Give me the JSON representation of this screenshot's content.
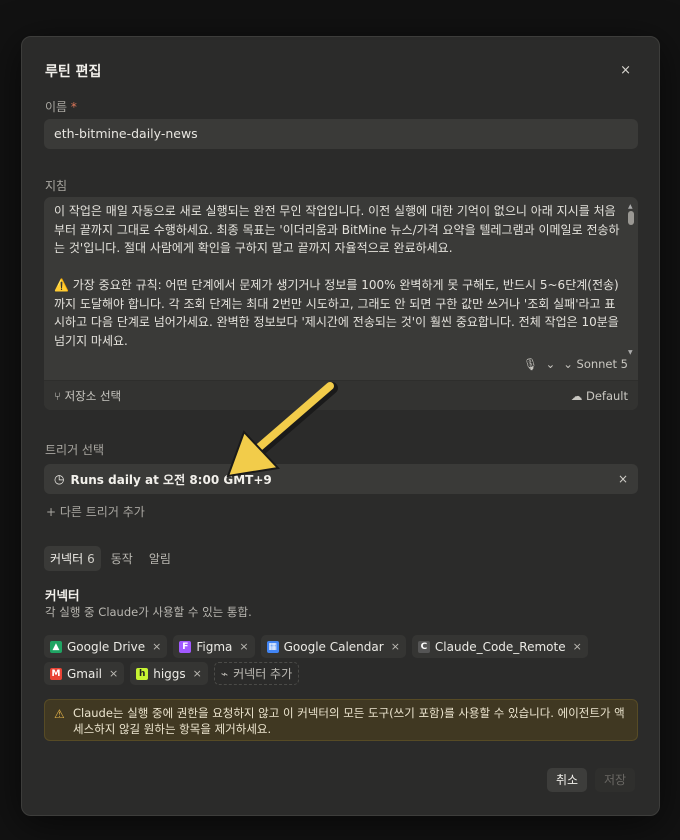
{
  "modal": {
    "title": "루틴 편집",
    "close_glyph": "×"
  },
  "name_field": {
    "label": "이름",
    "required_mark": "*",
    "value": "eth-bitmine-daily-news"
  },
  "instructions": {
    "label": "지침",
    "text": "이 작업은 매일 자동으로 새로 실행되는 완전 무인 작업입니다. 이전 실행에 대한 기억이 없으니 아래 지시를 처음부터 끝까지 그대로 수행하세요. 최종 목표는 '이더리움과 BitMine 뉴스/가격 요약을 텔레그램과 이메일로 전송하는 것'입니다. 절대 사람에게 확인을 구하지 말고 끝까지 자율적으로 완료하세요.\n\n⚠️ 가장 중요한 규칙: 어떤 단계에서 문제가 생기거나 정보를 100% 완벽하게 못 구해도, 반드시 5~6단계(전송)까지 도달해야 합니다. 각 조회 단계는 최대 2번만 시도하고, 그래도 안 되면 구한 값만 쓰거나 '조회 실패'라고 표시하고 다음 단계로 넘어가세요. 완벽한 정보보다 '제시간에 전송되는 것'이 훨씬 중요합니다. 전체 작업은 10분을 넘기지 마세요.",
    "model_label": "Sonnet 5",
    "repo_label": "저장소 선택",
    "env_label": "Default"
  },
  "trigger": {
    "label": "트리거 선택",
    "value": "Runs daily at 오전 8:00 GMT+9",
    "add_label": "+ 다른 트리거 추가"
  },
  "tabs": [
    {
      "label": "커넥터",
      "count": "6"
    },
    {
      "label": "동작",
      "count": ""
    },
    {
      "label": "알림",
      "count": ""
    }
  ],
  "connectors": {
    "title": "커넥터",
    "description": "각 실행 중 Claude가 사용할 수 있는 통합.",
    "items": [
      {
        "name": "Google Drive",
        "icon": "google-drive-icon",
        "color": "#1fa463"
      },
      {
        "name": "Figma",
        "icon": "figma-icon",
        "color": "#a259ff"
      },
      {
        "name": "Google Calendar",
        "icon": "google-calendar-icon",
        "color": "#4285f4"
      },
      {
        "name": "Claude_Code_Remote",
        "icon": "claude-code-icon",
        "color": "#555555"
      },
      {
        "name": "Gmail",
        "icon": "gmail-icon",
        "color": "#ea4335"
      },
      {
        "name": "higgs",
        "icon": "higgs-icon",
        "color": "#c6f432"
      }
    ],
    "add_label": "커넥터 추가"
  },
  "warning": {
    "text": "Claude는 실행 중에 권한을 요청하지 않고 이 커넥터의 모든 도구(쓰기 포함)를 사용할 수 있습니다. 에이전트가 액세스하지 않길 원하는 항목을 제거하세요."
  },
  "footer": {
    "cancel_label": "취소",
    "save_label": "저장"
  },
  "colors": {
    "arrow": "#f2cc4a",
    "warning_bg": "#403822"
  }
}
